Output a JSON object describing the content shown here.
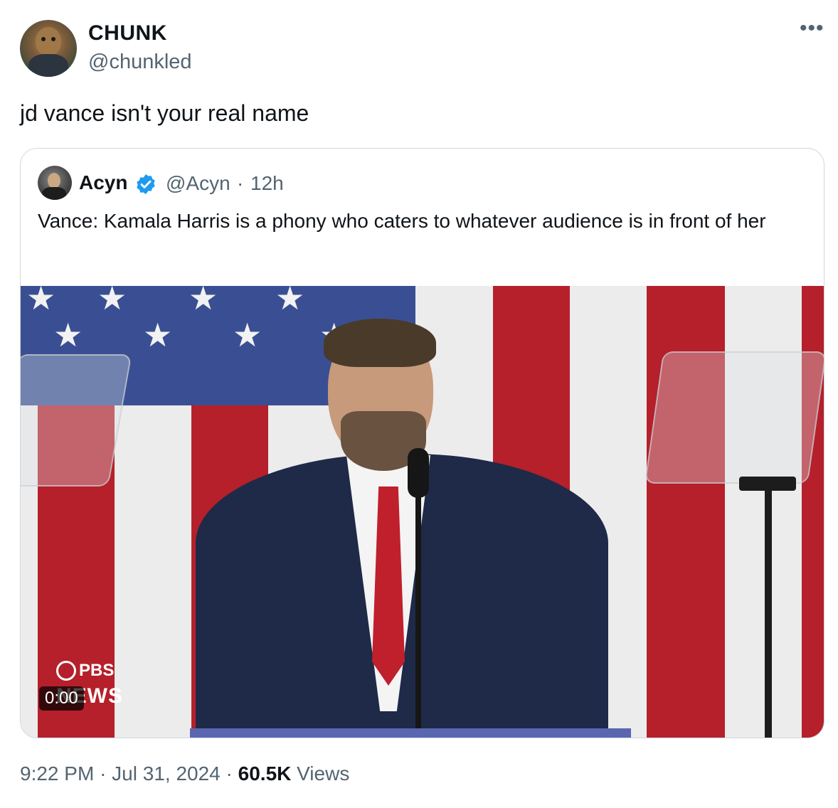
{
  "tweet": {
    "author_name": "CHUNK",
    "author_handle": "@chunkled",
    "more_label": "•••",
    "text": "jd vance isn't your real name",
    "time": "9:22 PM",
    "date": "Jul 31, 2024",
    "views_count": "60.5K",
    "views_label": "Views",
    "sep": "·"
  },
  "quote": {
    "author_name": "Acyn",
    "author_handle": "@Acyn",
    "sep": "·",
    "time": "12h",
    "text": "Vance: Kamala Harris is a phony who caters to whatever audience is in front of her",
    "video_time": "0:00",
    "overlay_logo": "PBS",
    "overlay_news": "NEWS"
  },
  "colors": {
    "verified": "#1d9bf0",
    "flag_red": "#b5202a",
    "flag_blue": "#3a4f93"
  }
}
